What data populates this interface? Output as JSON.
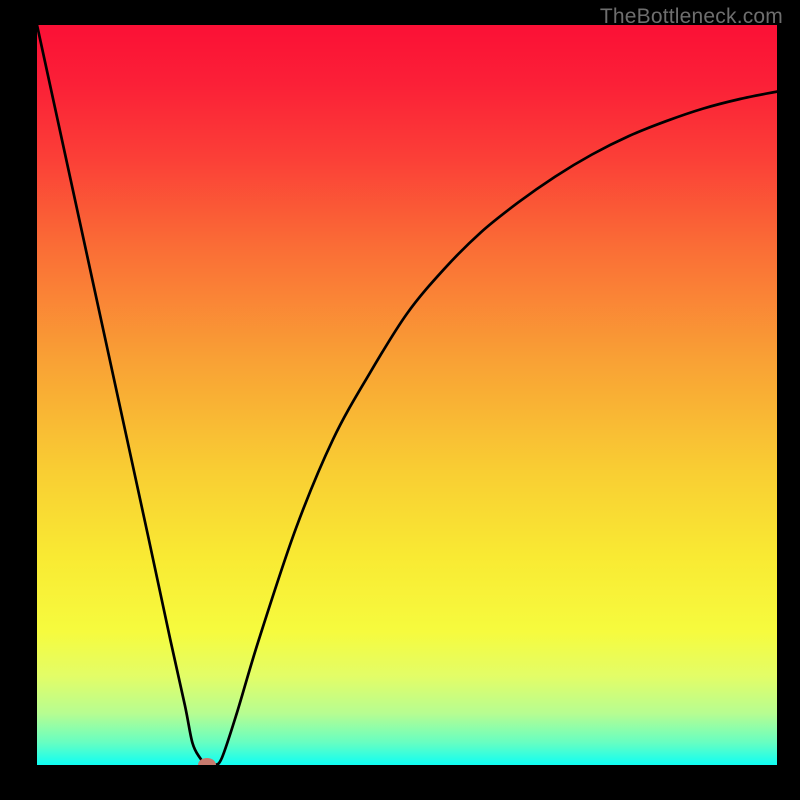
{
  "watermark": "TheBottleneck.com",
  "chart_data": {
    "type": "line",
    "title": "",
    "xlabel": "",
    "ylabel": "",
    "xlim": [
      0,
      100
    ],
    "ylim": [
      0,
      100
    ],
    "series": [
      {
        "name": "bottleneck-curve",
        "x": [
          0,
          5,
          10,
          15,
          18,
          20,
          21,
          22,
          23,
          24,
          25,
          27,
          30,
          35,
          40,
          45,
          50,
          55,
          60,
          65,
          70,
          75,
          80,
          85,
          90,
          95,
          100
        ],
        "values": [
          100,
          77,
          54,
          31,
          17,
          8,
          3,
          1,
          0,
          0,
          1,
          7,
          17,
          32,
          44,
          53,
          61,
          67,
          72,
          76,
          79.5,
          82.5,
          85,
          87,
          88.7,
          90,
          91
        ]
      }
    ],
    "marker": {
      "x": 23,
      "y": 0,
      "color": "#c77a6e"
    },
    "gradient_stops": [
      {
        "offset": 0,
        "color": "#fb1036"
      },
      {
        "offset": 0.08,
        "color": "#fb2037"
      },
      {
        "offset": 0.18,
        "color": "#fb3f37"
      },
      {
        "offset": 0.3,
        "color": "#fa6d36"
      },
      {
        "offset": 0.45,
        "color": "#f9a035"
      },
      {
        "offset": 0.6,
        "color": "#f9cd33"
      },
      {
        "offset": 0.72,
        "color": "#f9ea33"
      },
      {
        "offset": 0.82,
        "color": "#f6fb3e"
      },
      {
        "offset": 0.88,
        "color": "#e3fd67"
      },
      {
        "offset": 0.93,
        "color": "#b7fd91"
      },
      {
        "offset": 0.97,
        "color": "#66fec2"
      },
      {
        "offset": 1.0,
        "color": "#0ffef4"
      }
    ]
  }
}
